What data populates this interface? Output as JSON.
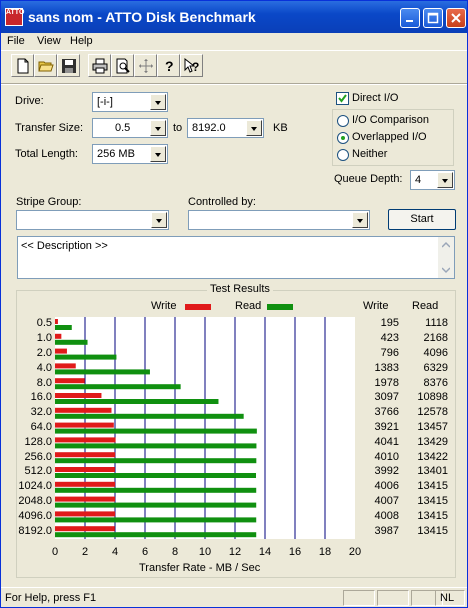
{
  "window": {
    "title": "sans nom - ATTO Disk Benchmark",
    "icon_text": "ATTO"
  },
  "menu": {
    "file": "File",
    "view": "View",
    "help": "Help"
  },
  "toolbar": {
    "icons": [
      "new-document-icon",
      "open-folder-icon",
      "save-icon",
      "print-icon",
      "print-preview-icon",
      "move-icon",
      "help-icon",
      "context-help-icon"
    ]
  },
  "form": {
    "drive_label": "Drive:",
    "drive_value": "[-i-]",
    "transfer_size_label": "Transfer Size:",
    "transfer_from": "0.5",
    "to_label": "to",
    "transfer_to": "8192.0",
    "kb_label": "KB",
    "total_length_label": "Total Length:",
    "total_length_value": "256 MB",
    "direct_io_label": "Direct I/O",
    "direct_io_checked": true,
    "io_options": [
      {
        "label": "I/O Comparison",
        "selected": false
      },
      {
        "label": "Overlapped I/O",
        "selected": true
      },
      {
        "label": "Neither",
        "selected": false
      }
    ],
    "queue_depth_label": "Queue Depth:",
    "queue_depth_value": "4",
    "stripe_group_label": "Stripe Group:",
    "stripe_group_value": "",
    "controlled_by_label": "Controlled by:",
    "controlled_by_value": "",
    "start_button": "Start",
    "description": "<< Description >>"
  },
  "results": {
    "title": "Test Results",
    "legend_write": "Write",
    "legend_read": "Read",
    "col_write": "Write",
    "col_read": "Read",
    "xlabel": "Transfer Rate - MB / Sec",
    "xticks": [
      "0",
      "2",
      "4",
      "6",
      "8",
      "10",
      "12",
      "14",
      "16",
      "18",
      "20"
    ],
    "colors": {
      "write": "#e01a1a",
      "read": "#109010",
      "grid": "#00007f"
    }
  },
  "chart_data": {
    "type": "bar",
    "orientation": "horizontal",
    "title": "Test Results",
    "xlabel": "Transfer Rate - MB / Sec",
    "xlim": [
      0,
      20
    ],
    "categories": [
      "0.5",
      "1.0",
      "2.0",
      "4.0",
      "8.0",
      "16.0",
      "32.0",
      "64.0",
      "128.0",
      "256.0",
      "512.0",
      "1024.0",
      "2048.0",
      "4096.0",
      "8192.0"
    ],
    "series": [
      {
        "name": "Write",
        "values": [
          195,
          423,
          796,
          1383,
          1978,
          3097,
          3766,
          3921,
          4041,
          4010,
          3992,
          4006,
          4007,
          4008,
          3987
        ]
      },
      {
        "name": "Read",
        "values": [
          1118,
          2168,
          4096,
          6329,
          8376,
          10898,
          12578,
          13457,
          13429,
          13422,
          13401,
          13415,
          13415,
          13415,
          13415
        ]
      }
    ],
    "legend": "top"
  },
  "status": {
    "text": "For Help, press F1",
    "indicator": "NL"
  }
}
